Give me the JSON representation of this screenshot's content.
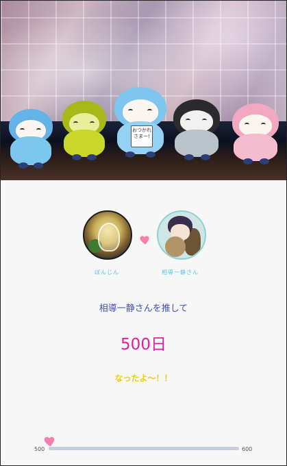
{
  "header_photo": {
    "sign_text": "おつかれさまー!"
  },
  "profile_left": {
    "name": "ぽんじん"
  },
  "profile_right": {
    "name": "相導一静さん"
  },
  "message": {
    "support_text": "相導一静さんを推して",
    "days_text": "500日",
    "became_text": "なったよ～！！"
  },
  "slider": {
    "min_label": "500",
    "max_label": "600",
    "value": 500
  },
  "colors": {
    "heart": "#f77fb0",
    "support_text": "#3d4fb0",
    "days_text": "#e21e9d",
    "became_text": "#f0d100",
    "name_text": "#53c6e0",
    "track": "#c3cfdc"
  }
}
